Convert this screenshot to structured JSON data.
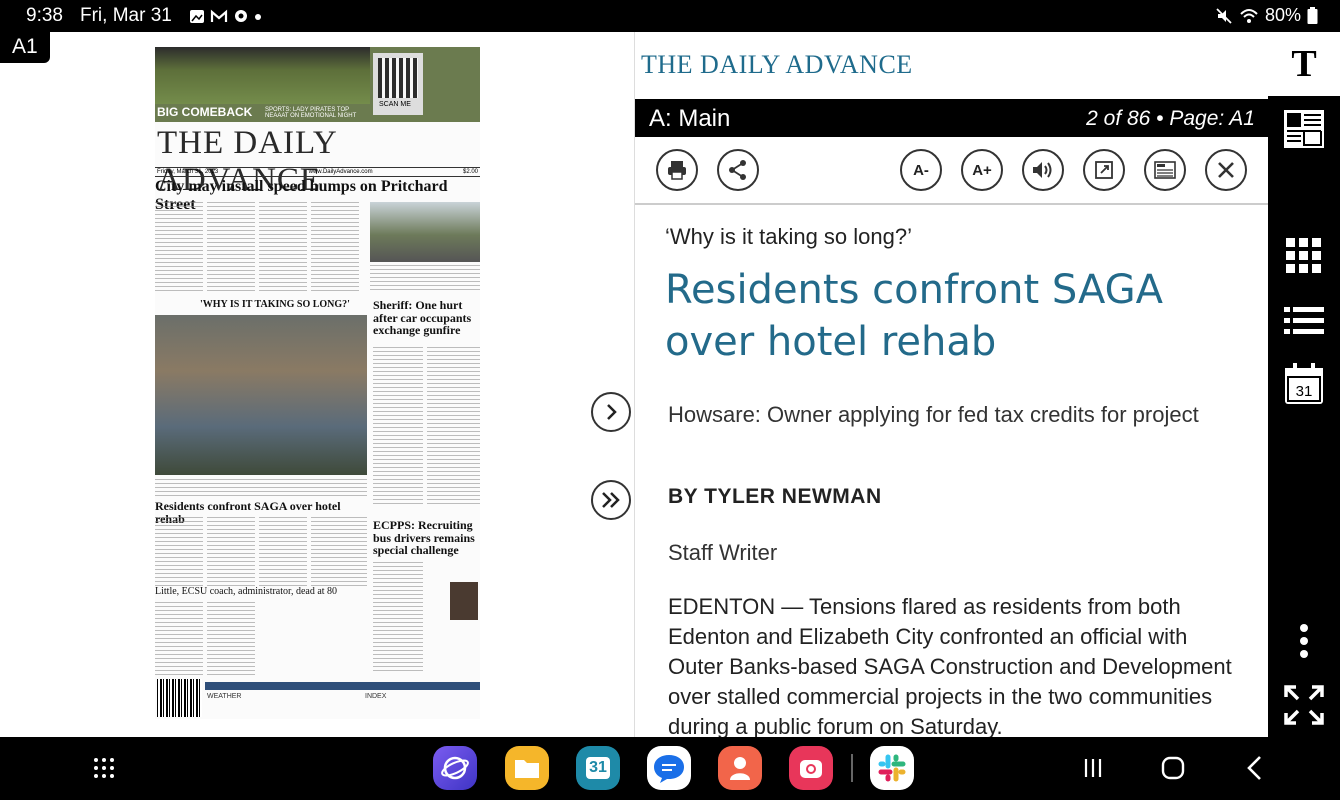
{
  "status": {
    "time": "9:38",
    "date": "Fri, Mar 31",
    "battery": "80%",
    "icons": [
      "gallery-icon",
      "gmail-icon",
      "settings-icon",
      "dot-icon"
    ],
    "right_icons": [
      "mute-icon",
      "wifi-icon",
      "battery-icon"
    ]
  },
  "page": {
    "badge": "A1",
    "newspaper": {
      "kicker": "BIG COMEBACK",
      "kicker_sub": "SPORTS: LADY PIRATES TOP NEAAAT ON EMOTIONAL NIGHT",
      "scan_me": "SCAN ME",
      "masthead": "THE DAILY ADVANCE",
      "dateline_left": "Friday, March 31, 2023",
      "dateline_mid": "www.DailyAdvance.com",
      "dateline_right": "$2.00",
      "headline": "City may install speed humps on Pritchard Street",
      "story2_kicker": "'WHY IS IT TAKING SO LONG?'",
      "story2_head": "Residents confront SAGA over hotel rehab",
      "story3_head": "Sheriff: One hurt after car occupants exchange gunfire",
      "story4_head": "ECPPS: Recruiting bus drivers remains special challenge",
      "story5_head": "Little, ECSU coach, administrator, dead at 80",
      "weather": "WEATHER",
      "index": "INDEX"
    }
  },
  "article": {
    "logo": "THE DAILY ADVANCE",
    "section": "A: Main",
    "page_info": "2 of 86 • Page: A1",
    "toolbar": {
      "print": "print-icon",
      "share": "share-icon",
      "font_smaller": "A-",
      "font_larger": "A+",
      "listen": "speaker-icon",
      "open": "open-external-icon",
      "news": "news-icon",
      "close": "close-icon"
    },
    "kicker": "‘Why is it taking so long?’",
    "headline": "Residents confront SAGA over hotel rehab",
    "deck": "Howsare: Owner applying for fed tax credits for project",
    "byline": "BY TYLER NEWMAN",
    "staff": "Staff Writer",
    "body": "EDENTON — Tensions flared as residents from both Edenton and Elizabeth City confronted an official with Outer Banks-based SAGA Construction and Development over stalled commercial projects in the two communities during a public forum on Saturday."
  },
  "rail": {
    "top": "T",
    "calendar_day": "31",
    "icons": [
      "text-size-icon",
      "newspaper-icon",
      "grid-icon",
      "list-icon",
      "calendar-icon",
      "more-icon",
      "fullscreen-icon"
    ]
  },
  "navbar": {
    "calendar_day": "31",
    "apps": [
      "apps-grid-icon",
      "internet-icon",
      "files-icon",
      "calendar-icon",
      "messages-icon",
      "contacts-icon",
      "screen-recorder-icon",
      "slack-icon"
    ],
    "controls": [
      "recents-icon",
      "home-icon",
      "back-icon"
    ]
  }
}
